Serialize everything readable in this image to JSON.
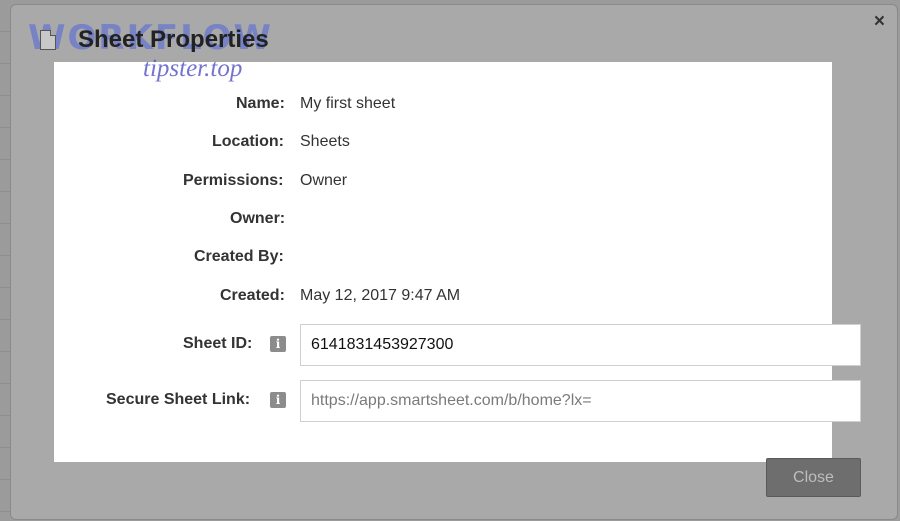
{
  "dialog": {
    "title": "Sheet Properties",
    "close_icon": "×",
    "close_button_label": "Close"
  },
  "watermark": {
    "top_text": "WORKFLOW",
    "bottom_text": "tipster.top"
  },
  "fields": {
    "name": {
      "label": "Name:",
      "value": "My first sheet"
    },
    "location": {
      "label": "Location:",
      "value": "Sheets"
    },
    "permissions": {
      "label": "Permissions:",
      "value": "Owner"
    },
    "owner": {
      "label": "Owner:",
      "value": ""
    },
    "created_by": {
      "label": "Created By:",
      "value": ""
    },
    "created": {
      "label": "Created:",
      "value": "May 12, 2017 9:47 AM"
    },
    "sheet_id": {
      "label": "Sheet ID:",
      "value": "6141831453927300"
    },
    "secure_link": {
      "label": "Secure Sheet Link:",
      "value": "https://app.smartsheet.com/b/home?lx="
    }
  },
  "icons": {
    "info": "i",
    "document": "document-icon"
  },
  "colors": {
    "overlay": "#9b9b9b",
    "panel": "#ffffff",
    "button": "#6e6e6e",
    "watermark_blue": "#5064dc"
  }
}
